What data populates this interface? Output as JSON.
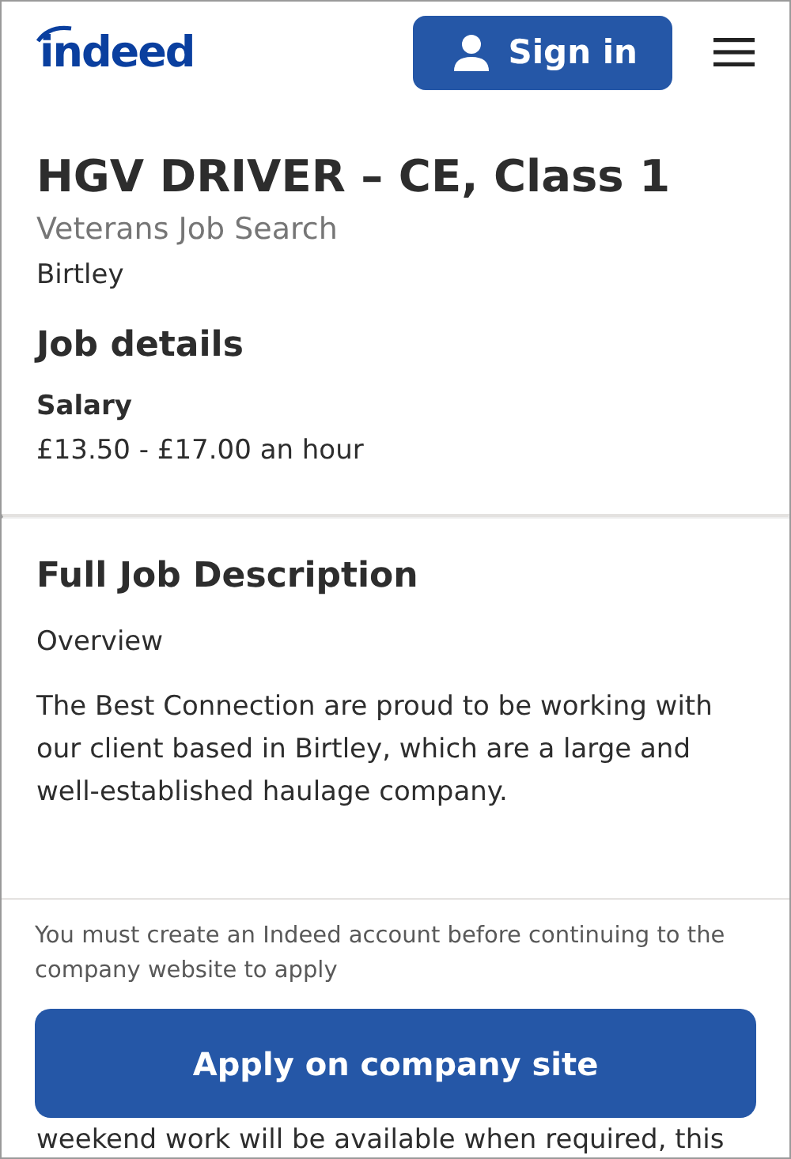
{
  "header": {
    "logo": "indeed",
    "sign_in": "Sign in"
  },
  "job": {
    "title": "HGV DRIVER – CE, Class 1",
    "company": "Veterans Job Search",
    "location": "Birtley"
  },
  "job_details": {
    "heading": "Job details",
    "salary_label": "Salary",
    "salary": "£13.50 - £17.00 an hour"
  },
  "description": {
    "heading": "Full Job Description",
    "paragraphs": [
      "Overview",
      "The Best Connection are proud to be working with our client based in Birtley, which are a large and well-established haulage company."
    ]
  },
  "apply_panel": {
    "notice": "You must create an Indeed account before continuing to the company website to apply",
    "button": "Apply on company site"
  },
  "trailing_text": "weekend work will be available when required, this"
}
